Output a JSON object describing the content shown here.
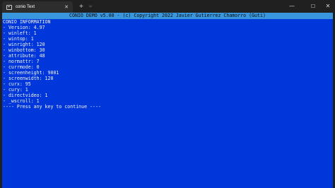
{
  "window": {
    "tab_title": "conio Text",
    "tab_close": "✕",
    "new_tab": "+",
    "tab_menu": "⌵",
    "minimize": "—",
    "maximize": "☐",
    "close": "✕"
  },
  "console": {
    "header": "CONIO DEMO v5.00 - (c) Copyright 2022 Javier Gutierrez Chamorro (Guti)",
    "lines": [
      "CONIO INFORMATION",
      "- Version: 4.97",
      "- winleft: 1",
      "- wintop: 1",
      "- winright: 120",
      "- winbottom: 30",
      "- attribute: 48",
      "- normattr: 7",
      "- currmode: 0",
      "- screenheight: 9001",
      "- screenwidth: 120",
      "- curx: 95",
      "- cury: 1",
      "- directvideo: 1",
      "- _wscroll: 1",
      "---- Press any key to continue ----"
    ],
    "colors": {
      "background": "#0037da",
      "header_bg": "#3a96dd",
      "text": "#f2f2f2"
    }
  }
}
